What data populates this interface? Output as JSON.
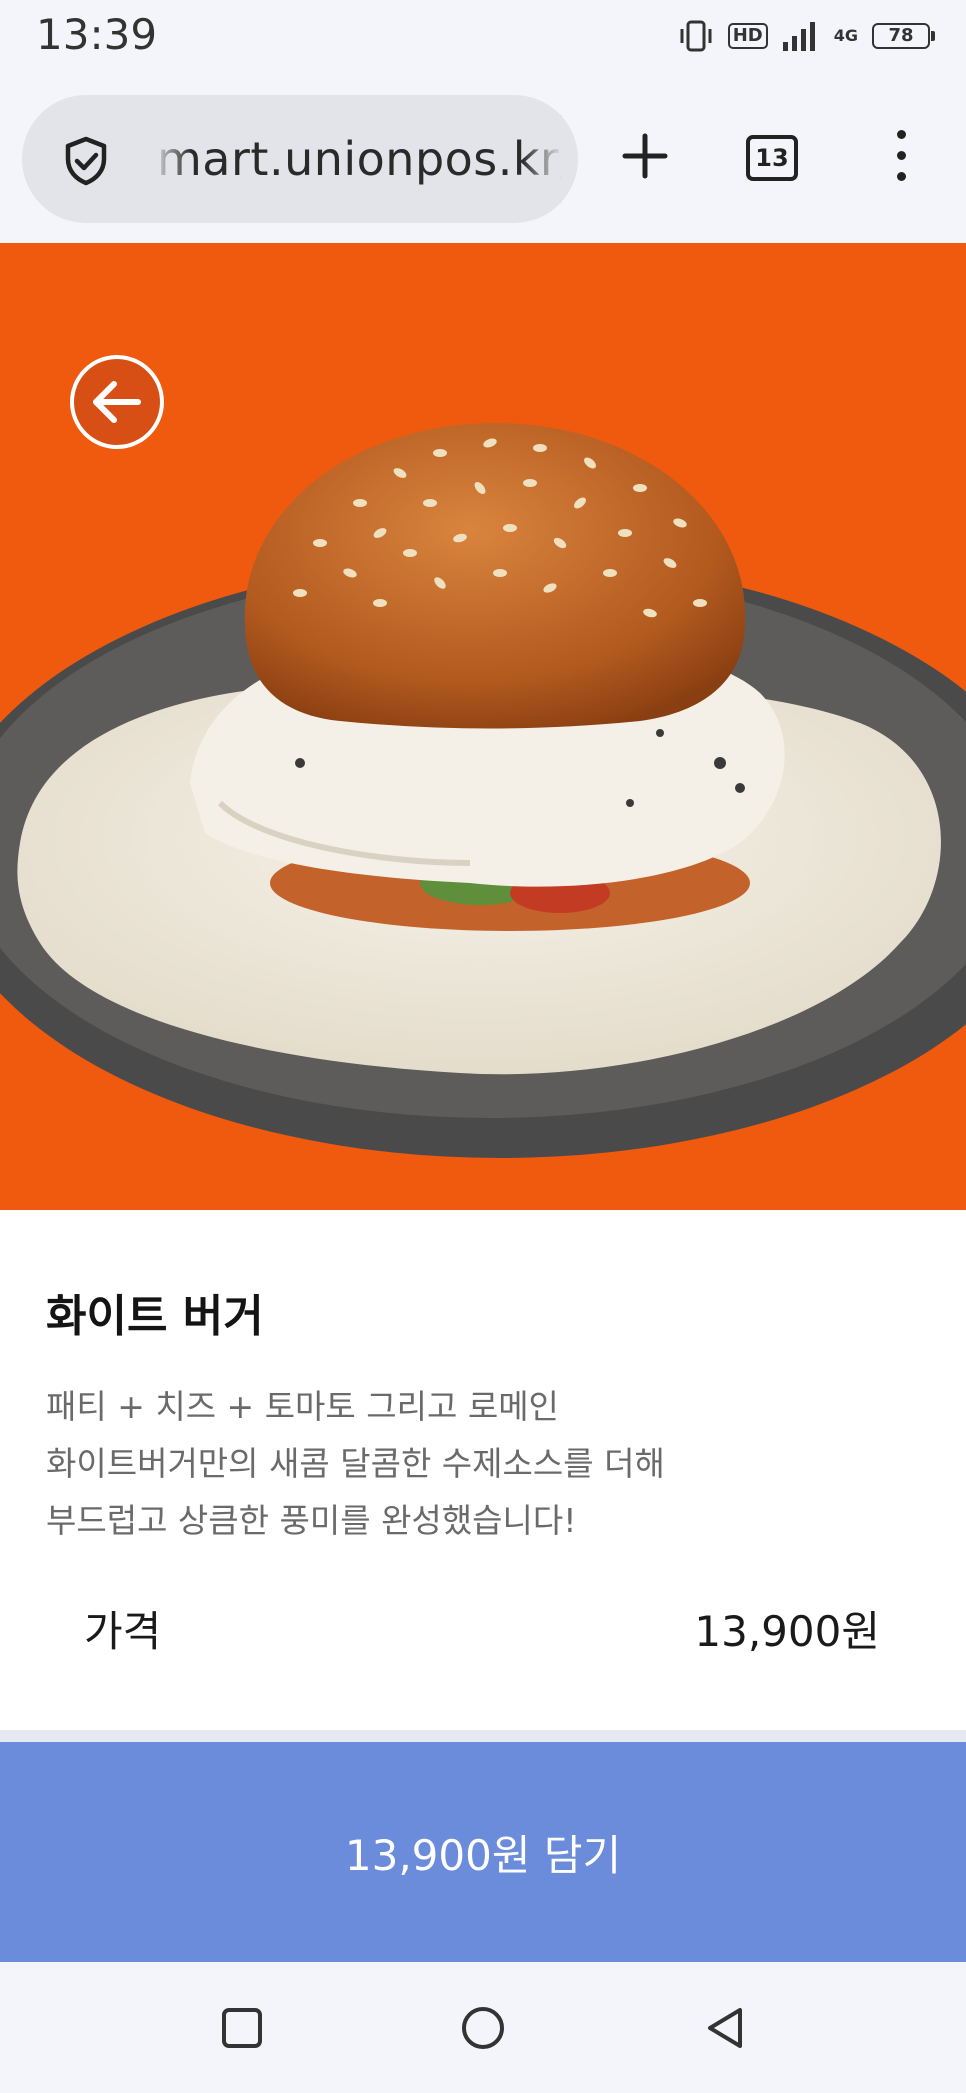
{
  "status_bar": {
    "time": "13:39",
    "hd_label": "HD",
    "network_label": "4G",
    "battery_level": "78",
    "icons": [
      "vibrate-icon",
      "hd-icon",
      "signal-icon",
      "battery-icon"
    ]
  },
  "browser": {
    "url": "mart.unionpos.kr/",
    "tab_count": "13",
    "icons": [
      "shield-icon",
      "plus-icon",
      "tabs-icon",
      "more-vert-icon"
    ]
  },
  "product": {
    "name": "화이트 버거",
    "description": [
      "패티 + 치즈 + 토마토 그리고 로메인",
      "화이트버거만의 새콤 달콤한 수제소스를 더해",
      "부드럽고 상큼한 풍미를 완성했습니다!"
    ],
    "price_label": "가격",
    "price_value": "13,900원"
  },
  "cart_button": {
    "label": "13,900원 담기"
  },
  "colors": {
    "hero_background": "#ef5a0f",
    "cart_button": "#6b8bdb",
    "title_text": "#141414",
    "description_text": "#6a6a6a"
  },
  "nav_bar": {
    "icons": [
      "recents-square-icon",
      "home-circle-icon",
      "back-triangle-icon"
    ]
  }
}
